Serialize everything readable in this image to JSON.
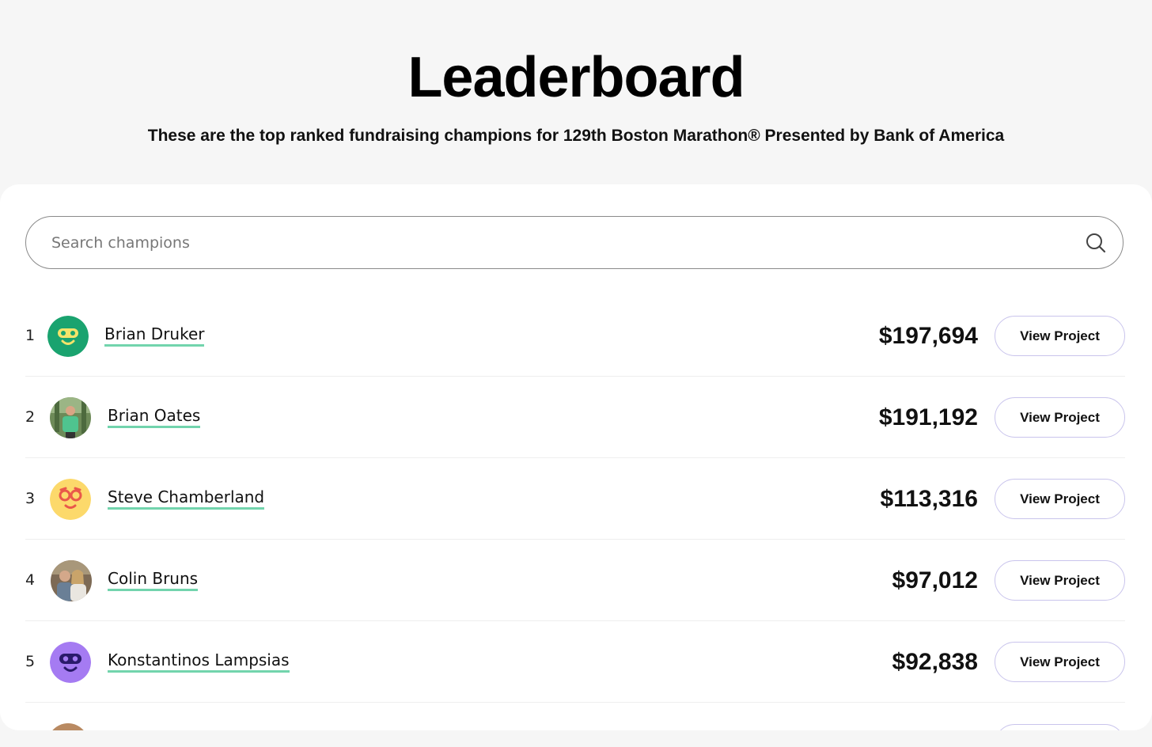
{
  "header": {
    "title": "Leaderboard",
    "subtitle": "These are the top ranked fundraising champions for 129th Boston Marathon® Presented by Bank of America"
  },
  "search": {
    "placeholder": "Search champions",
    "value": ""
  },
  "leaderboard": [
    {
      "rank": "1",
      "name": "Brian Druker",
      "amount": "$197,694",
      "button_label": "View Project",
      "avatar": "green-face-icon"
    },
    {
      "rank": "2",
      "name": "Brian Oates",
      "amount": "$191,192",
      "button_label": "View Project",
      "avatar": "photo-runner"
    },
    {
      "rank": "3",
      "name": "Steve Chamberland",
      "amount": "$113,316",
      "button_label": "View Project",
      "avatar": "yellow-face-icon"
    },
    {
      "rank": "4",
      "name": "Colin Bruns",
      "amount": "$97,012",
      "button_label": "View Project",
      "avatar": "photo-couple"
    },
    {
      "rank": "5",
      "name": "Konstantinos Lampsias",
      "amount": "$92,838",
      "button_label": "View Project",
      "avatar": "purple-face-icon"
    }
  ],
  "colors": {
    "name_underline": "#72d4ad",
    "button_border": "#c9c4ec",
    "avatar_green": "#1aa36f",
    "avatar_yellow": "#fcd96b",
    "avatar_purple": "#a57bf2"
  }
}
